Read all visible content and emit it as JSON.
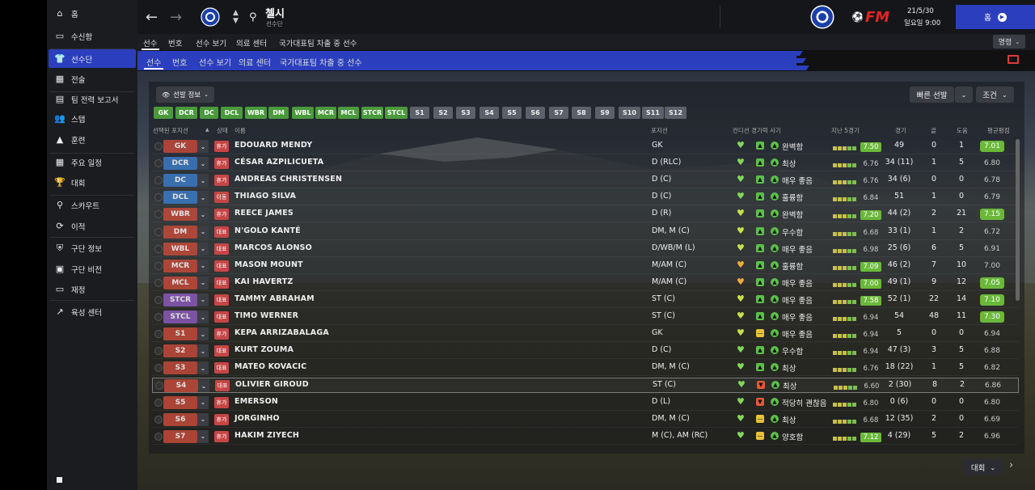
{
  "sidebar": {
    "items": [
      {
        "label": "홈",
        "icon": "home-icon",
        "glyph": "⌂"
      },
      {
        "label": "수신함",
        "icon": "inbox-icon",
        "glyph": "▭"
      },
      {
        "label": "선수단",
        "icon": "shirt-icon",
        "glyph": "👕",
        "active": true
      },
      {
        "label": "전술",
        "icon": "tactics-icon",
        "glyph": "▦"
      },
      {
        "label": "팀 전력 보고서",
        "icon": "report-icon",
        "glyph": "▤"
      },
      {
        "label": "스탭",
        "icon": "staff-icon",
        "glyph": "👥"
      },
      {
        "label": "훈련",
        "icon": "training-icon",
        "glyph": "▲"
      },
      {
        "label": "주요 일정",
        "icon": "calendar-icon",
        "glyph": "▦"
      },
      {
        "label": "대회",
        "icon": "trophy-icon",
        "glyph": "🏆"
      },
      {
        "label": "스카우트",
        "icon": "scout-icon",
        "glyph": "⚲"
      },
      {
        "label": "이적",
        "icon": "transfer-icon",
        "glyph": "⟳"
      },
      {
        "label": "구단 정보",
        "icon": "club-info-icon",
        "glyph": "⛨"
      },
      {
        "label": "구단 비전",
        "icon": "vision-icon",
        "glyph": "▣"
      },
      {
        "label": "재정",
        "icon": "finance-icon",
        "glyph": "▭"
      },
      {
        "label": "육성 센터",
        "icon": "development-icon",
        "glyph": "↗"
      }
    ]
  },
  "topbar": {
    "club_name": "첼시",
    "club_sub": "선수단",
    "date": "21/5/30",
    "day_time": "일요일 9:00",
    "home_label": "홈",
    "brand": "FM"
  },
  "nav_tabs": [
    "선수",
    "번호",
    "선수 보기",
    "의료 센터",
    "국가대표팀 차출 중 선수"
  ],
  "command_label": "명령",
  "toolbar": {
    "selection_info": "선발 정보",
    "quick_pick": "빠른 선발",
    "condition": "조건"
  },
  "position_chips_green": [
    "GK",
    "DCR",
    "DC",
    "DCL",
    "WBR",
    "DM",
    "WBL",
    "MCR",
    "MCL",
    "STCR",
    "STCL"
  ],
  "position_chips_sub": [
    "S1",
    "S2",
    "S3",
    "S4",
    "S5",
    "S6",
    "S7",
    "S8",
    "S9",
    "S10",
    "S11",
    "S12"
  ],
  "headers": {
    "selected_pos": "선택된 포지션",
    "status": "상태",
    "name": "이름",
    "position": "포지션",
    "condition": "컨디션",
    "match_sharpness": "경기력 사기",
    "last5": "지난 5경기",
    "apps": "경기",
    "goals": "골",
    "assists": "도움",
    "avg_rating": "평균평점"
  },
  "players": [
    {
      "pos": "GK",
      "pos_color": "#c24a3a",
      "status": "휴가",
      "name": "EDOUARD MENDY",
      "position": "GK",
      "mood": "green",
      "sharp_icon": "green",
      "sharp": "완벽함",
      "last_rating": "7.50",
      "apps": "49",
      "goals": "0",
      "assists": "1",
      "avg": "7.01",
      "avg_hl": true,
      "last_hl": true
    },
    {
      "pos": "DCR",
      "pos_color": "#3b7ac4",
      "status": "휴가",
      "name": "CÉSAR AZPILICUETA",
      "position": "D (RLC)",
      "mood": "green",
      "sharp_icon": "green",
      "sharp": "최상",
      "last_rating": "6.76",
      "apps": "34 (11)",
      "goals": "1",
      "assists": "5",
      "avg": "6.80",
      "avg_hl": false,
      "last_hl": false
    },
    {
      "pos": "DC",
      "pos_color": "#3b7ac4",
      "status": "휴가",
      "name": "ANDREAS CHRISTENSEN",
      "position": "D (C)",
      "mood": "green",
      "sharp_icon": "green",
      "sharp": "매우 좋음",
      "last_rating": "6.76",
      "apps": "34 (6)",
      "goals": "0",
      "assists": "0",
      "avg": "6.78",
      "avg_hl": false,
      "last_hl": false
    },
    {
      "pos": "DCL",
      "pos_color": "#3b7ac4",
      "status": "이동",
      "name": "THIAGO SILVA",
      "position": "D (C)",
      "mood": "green",
      "sharp_icon": "green",
      "sharp": "훌륭함",
      "last_rating": "6.84",
      "apps": "51",
      "goals": "1",
      "assists": "0",
      "avg": "6.79",
      "avg_hl": false,
      "last_hl": false
    },
    {
      "pos": "WBR",
      "pos_color": "#c24a3a",
      "status": "휴가",
      "name": "REECE JAMES",
      "position": "D (R)",
      "mood": "yellowgreen",
      "sharp_icon": "green",
      "sharp": "완벽함",
      "last_rating": "7.20",
      "apps": "44 (2)",
      "goals": "2",
      "assists": "21",
      "avg": "7.15",
      "avg_hl": true,
      "last_hl": true
    },
    {
      "pos": "DM",
      "pos_color": "#c24a3a",
      "status": "대표",
      "name": "N'GOLO KANTÉ",
      "position": "DM, M (C)",
      "mood": "yellowgreen",
      "sharp_icon": "green",
      "sharp": "우수함",
      "last_rating": "6.68",
      "apps": "33 (1)",
      "goals": "1",
      "assists": "2",
      "avg": "6.72",
      "avg_hl": false,
      "last_hl": false
    },
    {
      "pos": "WBL",
      "pos_color": "#c24a3a",
      "status": "대표",
      "name": "MARCOS ALONSO",
      "position": "D/WB/M (L)",
      "mood": "yellowgreen",
      "sharp_icon": "green",
      "sharp": "매우 좋음",
      "last_rating": "6.98",
      "apps": "25 (6)",
      "goals": "6",
      "assists": "5",
      "avg": "6.91",
      "avg_hl": false,
      "last_hl": false
    },
    {
      "pos": "MCR",
      "pos_color": "#c24a3a",
      "status": "대표",
      "name": "MASON MOUNT",
      "position": "M/AM (C)",
      "mood": "orange",
      "sharp_icon": "green",
      "sharp": "훌륭함",
      "last_rating": "7.09",
      "apps": "46 (2)",
      "goals": "7",
      "assists": "10",
      "avg": "7.00",
      "avg_hl": false,
      "last_hl": true
    },
    {
      "pos": "MCL",
      "pos_color": "#c24a3a",
      "status": "대표",
      "name": "KAI HAVERTZ",
      "position": "M/AM (C)",
      "mood": "orange",
      "sharp_icon": "green",
      "sharp": "매우 좋음",
      "last_rating": "7.00",
      "apps": "49 (1)",
      "goals": "9",
      "assists": "12",
      "avg": "7.05",
      "avg_hl": true,
      "last_hl": true
    },
    {
      "pos": "STCR",
      "pos_color": "#8a5ab8",
      "status": "대표",
      "name": "TAMMY ABRAHAM",
      "position": "ST (C)",
      "mood": "yellowgreen",
      "sharp_icon": "green",
      "sharp": "매우 좋음",
      "last_rating": "7.58",
      "apps": "52 (1)",
      "goals": "22",
      "assists": "14",
      "avg": "7.10",
      "avg_hl": true,
      "last_hl": true
    },
    {
      "pos": "STCL",
      "pos_color": "#8a5ab8",
      "status": "대표",
      "name": "TIMO WERNER",
      "position": "ST (C)",
      "mood": "yellowgreen",
      "sharp_icon": "green",
      "sharp": "매우 좋음",
      "last_rating": "6.94",
      "apps": "54",
      "goals": "48",
      "assists": "11",
      "avg": "7.30",
      "avg_hl": true,
      "last_hl": false
    },
    {
      "pos": "S1",
      "pos_color": "#c24a3a",
      "status": "휴가",
      "name": "KEPA ARRIZABALAGA",
      "position": "GK",
      "mood": "yellowgreen",
      "sharp_icon": "yellow",
      "sharp": "매우 좋음",
      "last_rating": "6.94",
      "apps": "5",
      "goals": "0",
      "assists": "0",
      "avg": "6.94",
      "avg_hl": false,
      "last_hl": false
    },
    {
      "pos": "S2",
      "pos_color": "#c24a3a",
      "status": "대표",
      "name": "KURT ZOUMA",
      "position": "D (C)",
      "mood": "green",
      "sharp_icon": "green",
      "sharp": "우수함",
      "last_rating": "6.94",
      "apps": "47 (3)",
      "goals": "3",
      "assists": "5",
      "avg": "6.88",
      "avg_hl": false,
      "last_hl": false
    },
    {
      "pos": "S3",
      "pos_color": "#c24a3a",
      "status": "대표",
      "name": "MATEO KOVACIC",
      "position": "DM, M (C)",
      "mood": "green",
      "sharp_icon": "green",
      "sharp": "최상",
      "last_rating": "6.76",
      "apps": "18 (22)",
      "goals": "1",
      "assists": "5",
      "avg": "6.82",
      "avg_hl": false,
      "last_hl": false
    },
    {
      "pos": "S4",
      "pos_color": "#c24a3a",
      "status": "대표",
      "name": "OLIVIER GIROUD",
      "position": "ST (C)",
      "mood": "green",
      "sharp_icon": "red",
      "sharp": "최상",
      "last_rating": "6.60",
      "apps": "2 (30)",
      "goals": "8",
      "assists": "2",
      "avg": "6.86",
      "avg_hl": false,
      "last_hl": false,
      "selected": true
    },
    {
      "pos": "S5",
      "pos_color": "#c24a3a",
      "status": "휴가",
      "name": "EMERSON",
      "position": "D (L)",
      "mood": "green",
      "sharp_icon": "red",
      "sharp": "적당히 괜찮음",
      "last_rating": "6.80",
      "apps": "0 (6)",
      "goals": "0",
      "assists": "0",
      "avg": "6.80",
      "avg_hl": false,
      "last_hl": false
    },
    {
      "pos": "S6",
      "pos_color": "#c24a3a",
      "status": "휴가",
      "name": "JORGINHO",
      "position": "DM, M (C)",
      "mood": "green",
      "sharp_icon": "yellow",
      "sharp": "최상",
      "last_rating": "6.68",
      "apps": "12 (35)",
      "goals": "2",
      "assists": "0",
      "avg": "6.69",
      "avg_hl": false,
      "last_hl": false
    },
    {
      "pos": "S7",
      "pos_color": "#c24a3a",
      "status": "휴가",
      "name": "HAKIM ZIYECH",
      "position": "M (C), AM (RC)",
      "mood": "green",
      "sharp_icon": "yellow",
      "sharp": "양호함",
      "last_rating": "7.12",
      "apps": "4 (29)",
      "goals": "5",
      "assists": "2",
      "avg": "6.96",
      "avg_hl": false,
      "last_hl": true
    }
  ],
  "bottom_label": "대회"
}
